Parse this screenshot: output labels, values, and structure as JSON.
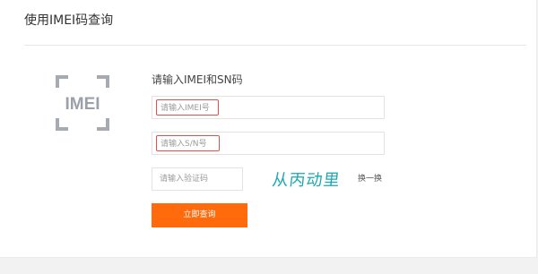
{
  "page": {
    "title": "使用IMEI码查询"
  },
  "logo": {
    "text": "IMEI",
    "color": "#9ba1a8"
  },
  "form": {
    "heading": "请输入IMEI和SN码",
    "imei_placeholder": "请输入IMEI号",
    "sn_placeholder": "请输入S/N号",
    "captcha_placeholder": "请输入验证码",
    "captcha_text": "从丙动里",
    "refresh_label": "换一换",
    "submit_label": "立即查询"
  },
  "colors": {
    "accent": "#ff6a0c",
    "highlight_border": "#e1514f",
    "captcha_text": "#1fa8b0"
  }
}
